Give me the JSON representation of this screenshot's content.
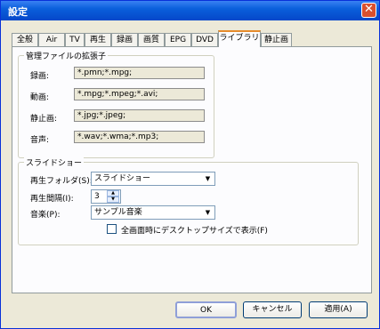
{
  "window": {
    "title": "設定",
    "close_glyph": "✕"
  },
  "tabs": [
    "全般",
    "Air",
    "TV",
    "再生",
    "録画",
    "画質",
    "EPG",
    "DVD",
    "ライブラリ",
    "静止画"
  ],
  "active_tab": "ライブラリ",
  "extensions": {
    "group_title": "管理ファイルの拡張子",
    "rows": [
      {
        "label": "録画:",
        "value": "*.pmn;*.mpg;"
      },
      {
        "label": "動画:",
        "value": "*.mpg;*.mpeg;*.avi;"
      },
      {
        "label": "静止画:",
        "value": "*.jpg;*.jpeg;"
      },
      {
        "label": "音声:",
        "value": "*.wav;*.wma;*.mp3;"
      }
    ]
  },
  "slideshow": {
    "group_title": "スライドショー",
    "folder_label": "再生フォルダ(S):",
    "folder_value": "スライドショー",
    "interval_label": "再生間隔(I):",
    "interval_value": "3",
    "music_label": "音楽(P):",
    "music_value": "サンプル音楽",
    "fullscreen_label": "全画面時にデスクトップサイズで表示(F)",
    "fullscreen_checked": false
  },
  "buttons": {
    "ok": "OK",
    "cancel": "キャンセル",
    "apply": "適用(A)"
  },
  "colors": {
    "titlebar": "#0a5fdb",
    "close": "#d9502f",
    "tab_highlight": "#e68b2c"
  }
}
